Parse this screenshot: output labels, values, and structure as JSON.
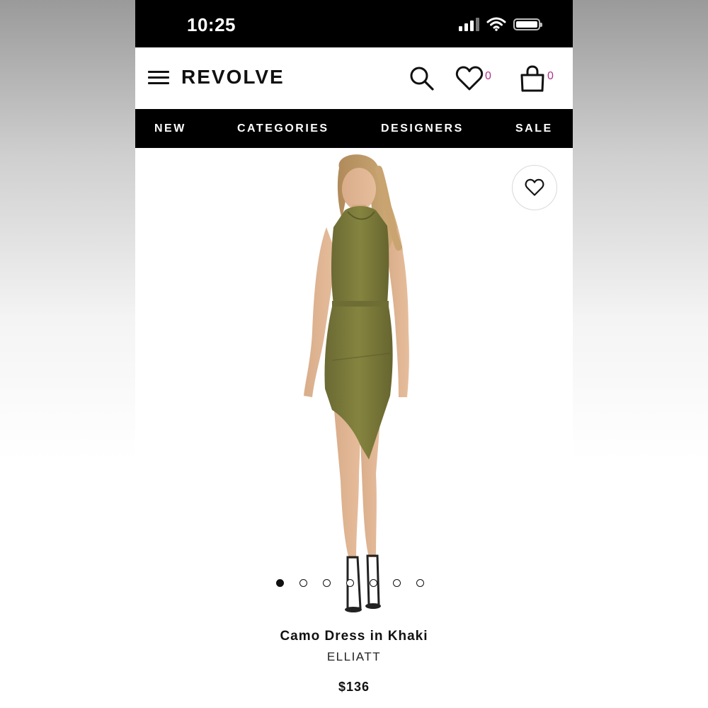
{
  "status_bar": {
    "time": "10:25"
  },
  "header": {
    "brand": "REVOLVE",
    "wishlist_count": "0",
    "bag_count": "0"
  },
  "nav": {
    "items": [
      {
        "label": "NEW"
      },
      {
        "label": "CATEGORIES"
      },
      {
        "label": "DESIGNERS"
      },
      {
        "label": "SALE"
      }
    ]
  },
  "product": {
    "name": "Camo Dress in Khaki",
    "brand": "ELLIATT",
    "price": "$136",
    "image_count": 7,
    "active_image": 1
  },
  "colors": {
    "accent_count": "#b0338c",
    "dress": "#7b7a3f"
  },
  "icons": [
    "menu-icon",
    "search-icon",
    "heart-icon",
    "bag-icon",
    "wifi-icon",
    "battery-icon",
    "signal-icon"
  ]
}
